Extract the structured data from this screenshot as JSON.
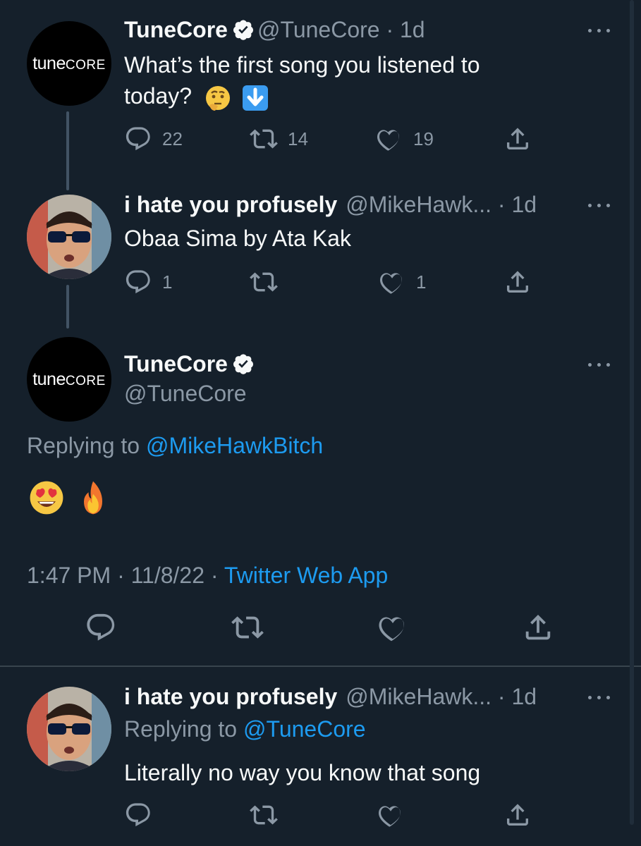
{
  "tweets": [
    {
      "avatar": {
        "logo_a": "tune",
        "logo_b": "CORE"
      },
      "name": "TuneCore",
      "verified": true,
      "handle": "@TuneCore",
      "time": "1d",
      "text": "What’s the first song you listened to",
      "text_line2": "today?",
      "emoji_icons": [
        "thinking-face-icon",
        "down-arrow-icon"
      ],
      "reply_count": "22",
      "retweet_count": "14",
      "like_count": "19"
    },
    {
      "name": "i hate you profusely",
      "handle": "@MikeHawk...",
      "time": "1d",
      "text": "Obaa Sima by Ata Kak",
      "reply_count": "1",
      "retweet_count": "",
      "like_count": "1"
    }
  ],
  "focused_tweet": {
    "avatar": {
      "logo_a": "tune",
      "logo_b": "CORE"
    },
    "name": "TuneCore",
    "verified": true,
    "handle": "@TuneCore",
    "replying_prefix": "Replying to",
    "replying_handle": "@MikeHawkBitch",
    "emoji_icons": [
      "heart-eyes-face-icon",
      "fire-icon"
    ],
    "time": "1:47 PM",
    "date": "11/8/22",
    "source": "Twitter Web App",
    "separator": "·"
  },
  "reply_tweet": {
    "name": "i hate you profusely",
    "handle": "@MikeHawk...",
    "time": "1d",
    "replying_prefix": "Replying to",
    "replying_handle": "@TuneCore",
    "text": "Literally no way you know that song"
  },
  "colors": {
    "background": "#15202b",
    "text": "#f7f9f9",
    "muted": "#8b98a5",
    "link": "#1d9bf0",
    "divider": "#38444d"
  }
}
